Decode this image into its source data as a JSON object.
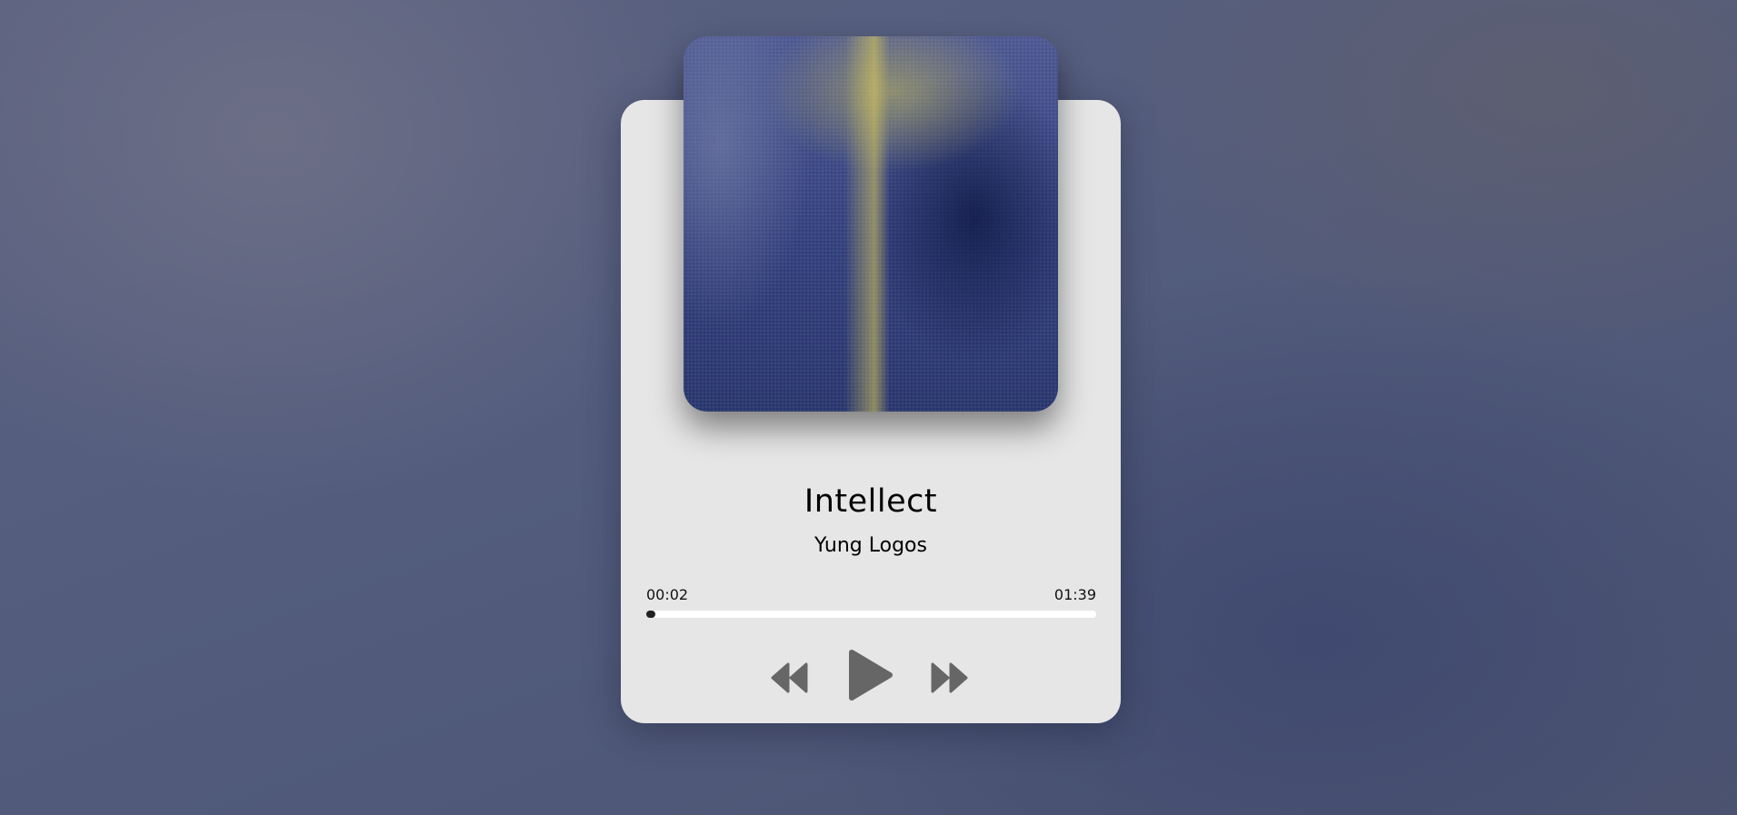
{
  "track": {
    "title": "Intellect",
    "artist": "Yung Logos"
  },
  "progress": {
    "current": "00:02",
    "duration": "01:39",
    "fraction": 0.02
  },
  "controls": {
    "prev_icon": "rewind-icon",
    "play_icon": "play-icon",
    "next_icon": "fast-forward-icon"
  },
  "colors": {
    "card": "#e6e6e6",
    "icon": "#666666",
    "progress_fill": "#222222"
  }
}
